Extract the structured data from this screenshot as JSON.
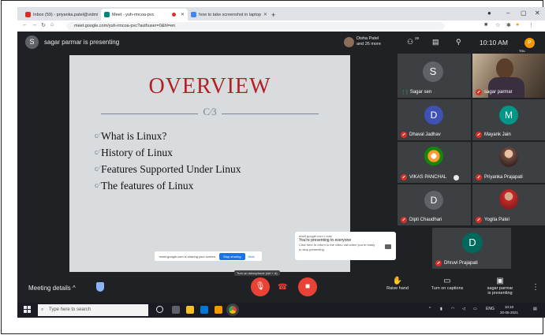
{
  "browser": {
    "tabs": [
      {
        "label": "Inbox (59) - priyanka.patel@vidmi",
        "fav_color": "#d93025"
      },
      {
        "label": "Meet - yuh-rmcoa-pvc",
        "fav_color": "#00897b"
      },
      {
        "label": "how to take screenshot in laptop",
        "fav_color": "#4285f4"
      }
    ],
    "new_tab": "+",
    "url": "meet.google.com/yuh-rmcoa-pvc?authuser=0&hl=en"
  },
  "meet": {
    "presenter_initial": "S",
    "presenting_text": "sagar parmar is presenting",
    "header_names": "Disha Patel",
    "header_more": "and 26 more",
    "participants_count": "28",
    "time": "10:10 AM",
    "you_initial": "P",
    "you_label": "You"
  },
  "slide": {
    "title": "OVERVIEW",
    "ornament": "C⁄3",
    "bullets": [
      "What is Linux?",
      "History of Linux",
      "Features Supported Under Linux",
      "The features of Linux"
    ],
    "share_bar_text": "meet.google.com is sharing your screen.",
    "stop_label": "Stop sharing",
    "hide_label": "Hide"
  },
  "notice": {
    "site": "meet.google.com • now",
    "title": "You're presenting to everyone",
    "body": "Click here to return to the video call when you're ready to stop presenting"
  },
  "participants": [
    {
      "name": "Sagar sen",
      "initial": "S",
      "color": "#5f6368"
    },
    {
      "name": "sagar parmar",
      "initial": "",
      "color": "#6d4c41"
    },
    {
      "name": "Dhaval Jadhav",
      "initial": "D",
      "color": "#3f51b5"
    },
    {
      "name": "Mayank Jain",
      "initial": "M",
      "color": "#009688"
    },
    {
      "name": "VIKAS PANCHAL",
      "initial": "",
      "color": "#2e7d32"
    },
    {
      "name": "Priyanka Prajapati",
      "initial": "",
      "color": "#795548"
    },
    {
      "name": "Dipti Chaudhari",
      "initial": "D",
      "color": "#5f6368"
    },
    {
      "name": "Yogita Patel",
      "initial": "",
      "color": "#c62828"
    },
    {
      "name": "Dhruvi Prajapati",
      "initial": "D",
      "color": "#00695c"
    }
  ],
  "controls": {
    "meeting_details": "Meeting details",
    "chevron": "^",
    "mic_tooltip": "Turn on microphone (ctrl + d)",
    "raise_hand": "Raise hand",
    "captions": "Turn on captions",
    "presenting_label_1": "sagar parmar",
    "presenting_label_2": "is presenting",
    "more": "⋮"
  },
  "taskbar": {
    "search_placeholder": "Type here to search",
    "lang": "ENG",
    "time": "10:10",
    "date": "20-05-2021"
  }
}
